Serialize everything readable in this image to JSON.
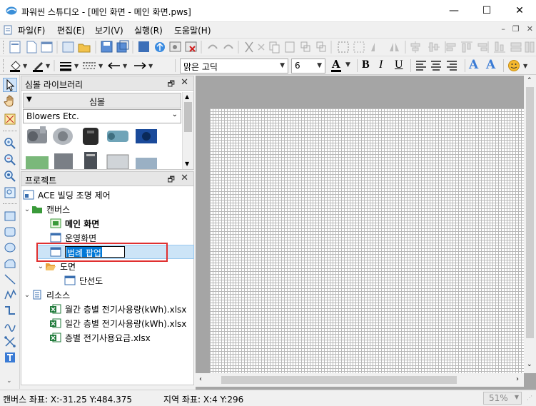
{
  "window": {
    "title": "파워씬 스튜디오 - [메인 화면 - 메인 화면.pws]",
    "minimize": "—",
    "maximize": "☐",
    "close": "✕"
  },
  "menu": {
    "items": [
      "파일(F)",
      "편집(E)",
      "보기(V)",
      "실행(R)",
      "도움말(H)"
    ],
    "mdi_min": "–",
    "mdi_restore": "❐",
    "mdi_close": "✕"
  },
  "toolbar2": {
    "font_name": "맑은 고딕",
    "font_size": "6",
    "bold": "B",
    "italic": "I",
    "underline": "U",
    "text_a1": "A",
    "text_a2": "A"
  },
  "symbol_panel": {
    "title": "심볼 라이브러리",
    "category_header": "심볼",
    "category_selected": "Blowers Etc.",
    "pin": "🗗",
    "close": "✕"
  },
  "project_panel": {
    "title": "프로젝트",
    "pin": "🗗",
    "close": "✕",
    "root": "ACE 빌딩 조명 제어",
    "canvases_folder": "캔버스",
    "canvases": [
      "메인 화면",
      "운영화면"
    ],
    "editing_value": "범례 팝업",
    "drawings_folder": "도면",
    "drawings": [
      "단선도"
    ],
    "resources_folder": "리소스",
    "resources": [
      "월간 층별 전기사용량(kWh).xlsx",
      "일간 층별 전기사용량(kWh).xlsx",
      "층별 전기사용요금.xlsx"
    ]
  },
  "status": {
    "canvas_coord": "캔버스 좌표: X:-31.25 Y:484.375",
    "region_coord": "지역 좌표: X:4 Y:296",
    "zoom": "51%"
  },
  "colors": {
    "accent_red": "#e03030",
    "selection_blue": "#1a6fe0",
    "folder_green": "#3a9a3a",
    "excel_green": "#1f7a3a"
  }
}
